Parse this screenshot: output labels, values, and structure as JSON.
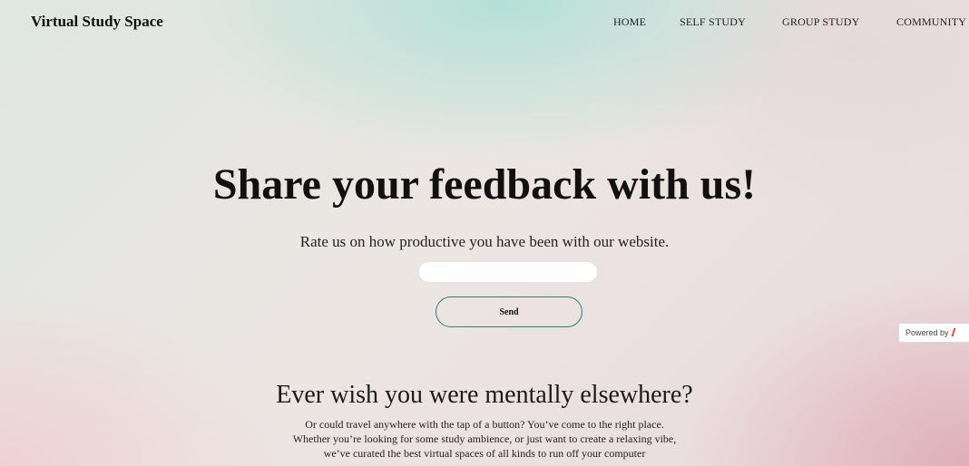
{
  "navbar": {
    "brand": "Virtual Study Space",
    "links": [
      {
        "label": "HOME"
      },
      {
        "label": "SELF STUDY"
      },
      {
        "label": "GROUP STUDY"
      },
      {
        "label": "COMMUNITY"
      }
    ]
  },
  "feedback": {
    "headline": "Share your feedback with us!",
    "subtext": "Rate us on how productive you have been with our website.",
    "input_value": "",
    "send_label": "Send"
  },
  "badge": {
    "label": "Powered by"
  },
  "intro": {
    "title": "Ever wish you were mentally elsewhere?",
    "lines": [
      "Or could travel anywhere with the tap of a button? You’ve come to the right place.",
      "Whether you’re looking for some study ambience, or just want to create a relaxing vibe,",
      "we’ve curated the best virtual spaces of all kinds to run off your computer"
    ]
  },
  "colors": {
    "accent_border": "#2f7d73",
    "badge_mark": "#e04a3a"
  }
}
